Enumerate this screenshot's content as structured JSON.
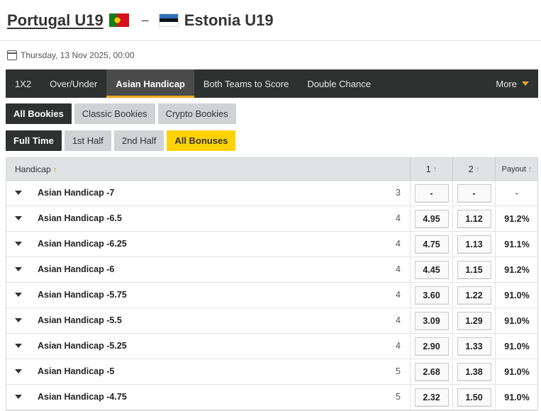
{
  "header": {
    "home_team": "Portugal U19",
    "separator": "–",
    "away_team": "Estonia U19",
    "home_flag": "portugal-flag",
    "away_flag": "estonia-flag"
  },
  "match_date": "Thursday, 13 Nov 2025, 00:00",
  "tabs": [
    {
      "label": "1X2",
      "active": false
    },
    {
      "label": "Over/Under",
      "active": false
    },
    {
      "label": "Asian Handicap",
      "active": true
    },
    {
      "label": "Both Teams to Score",
      "active": false
    },
    {
      "label": "Double Chance",
      "active": false
    }
  ],
  "more_label": "More",
  "bookie_filters": [
    {
      "label": "All Bookies",
      "active": true
    },
    {
      "label": "Classic Bookies",
      "active": false
    },
    {
      "label": "Crypto Bookies",
      "active": false
    }
  ],
  "period_filters": [
    {
      "label": "Full Time",
      "active": true
    },
    {
      "label": "1st Half",
      "active": false
    },
    {
      "label": "2nd Half",
      "active": false
    },
    {
      "label": "All Bonuses",
      "highlight": true
    }
  ],
  "table": {
    "col_handicap": "Handicap",
    "col_1": "1",
    "col_2": "2",
    "col_payout": "Payout",
    "rows": [
      {
        "name": "Asian Handicap -7",
        "count": "3",
        "odd1": "-",
        "odd2": "-",
        "payout": "-"
      },
      {
        "name": "Asian Handicap -6.5",
        "count": "4",
        "odd1": "4.95",
        "odd2": "1.12",
        "payout": "91.2%"
      },
      {
        "name": "Asian Handicap -6.25",
        "count": "4",
        "odd1": "4.75",
        "odd2": "1.13",
        "payout": "91.1%"
      },
      {
        "name": "Asian Handicap -6",
        "count": "4",
        "odd1": "4.45",
        "odd2": "1.15",
        "payout": "91.2%"
      },
      {
        "name": "Asian Handicap -5.75",
        "count": "4",
        "odd1": "3.60",
        "odd2": "1.22",
        "payout": "91.0%"
      },
      {
        "name": "Asian Handicap -5.5",
        "count": "4",
        "odd1": "3.09",
        "odd2": "1.29",
        "payout": "91.0%"
      },
      {
        "name": "Asian Handicap -5.25",
        "count": "4",
        "odd1": "2.90",
        "odd2": "1.33",
        "payout": "91.0%"
      },
      {
        "name": "Asian Handicap -5",
        "count": "5",
        "odd1": "2.68",
        "odd2": "1.38",
        "payout": "91.0%"
      },
      {
        "name": "Asian Handicap -4.75",
        "count": "5",
        "odd1": "2.32",
        "odd2": "1.50",
        "payout": "91.0%"
      }
    ]
  },
  "colors": {
    "nav_bg": "#2f3030",
    "accent_orange": "#f5a623",
    "bonus_yellow": "#ffd200"
  }
}
